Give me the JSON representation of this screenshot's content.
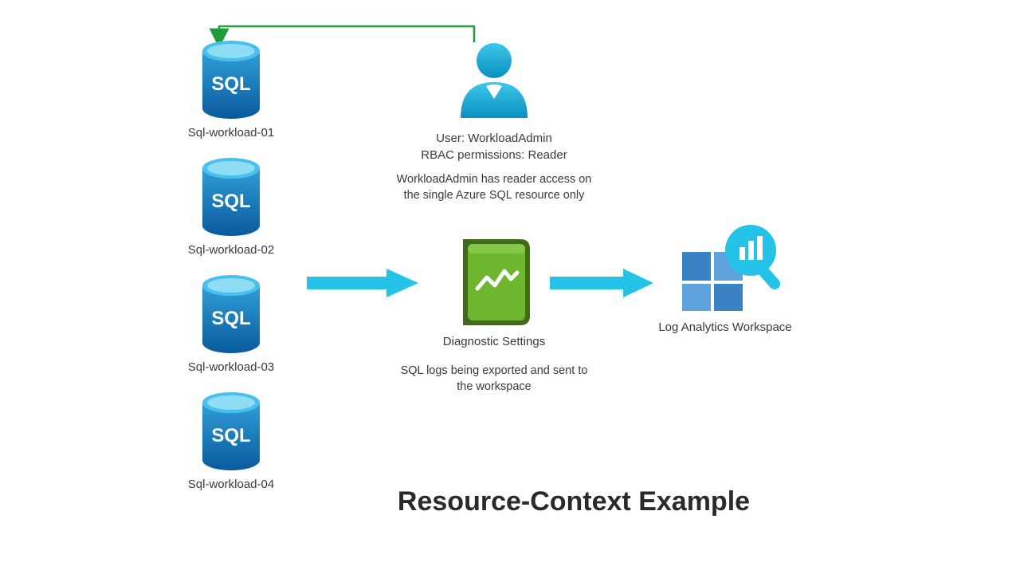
{
  "sql_workloads": [
    {
      "label": "Sql-workload-01"
    },
    {
      "label": "Sql-workload-02"
    },
    {
      "label": "Sql-workload-03"
    },
    {
      "label": "Sql-workload-04"
    }
  ],
  "user": {
    "line1": "User: WorkloadAdmin",
    "line2": "RBAC permissions: Reader",
    "desc_line1": "WorkloadAdmin has reader access on",
    "desc_line2": "the single Azure SQL resource only"
  },
  "diagnostic": {
    "label": "Diagnostic Settings",
    "desc_line1": "SQL logs being exported and sent to",
    "desc_line2": "the workspace"
  },
  "log_analytics": {
    "label": "Log Analytics Workspace"
  },
  "title": "Resource-Context Example",
  "icon_text": {
    "sql": "SQL"
  },
  "colors": {
    "cyan": "#22bce2",
    "green_arrow": "#1f9b3c",
    "db_blue": "#0f6fb8",
    "db_light": "#3aa8de",
    "diag_green": "#6bb42c",
    "diag_dark": "#4f8f20",
    "law_blue": "#3a82c4",
    "law_light": "#5fa3dc"
  }
}
